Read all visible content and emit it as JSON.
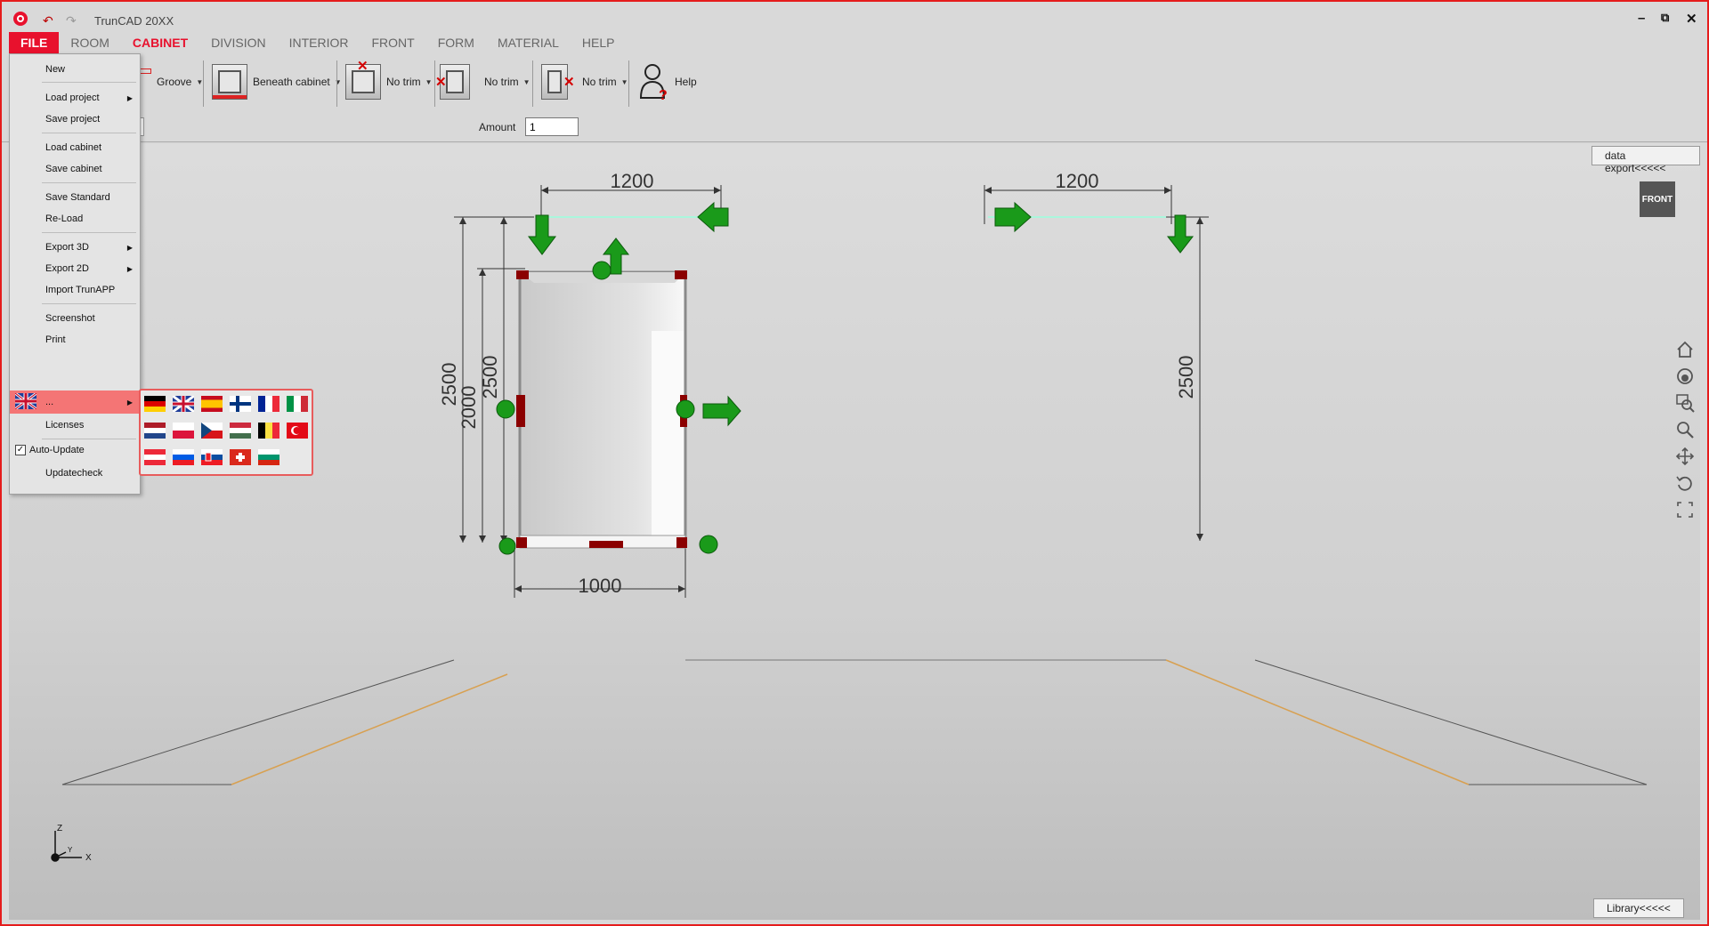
{
  "app": {
    "title": "TrunCAD 20XX",
    "window_controls": [
      "–",
      "⧉",
      "✕"
    ]
  },
  "menu": {
    "tabs": [
      {
        "label": "FILE"
      },
      {
        "label": "ROOM"
      },
      {
        "label": "CABINET"
      },
      {
        "label": "DIVISION"
      },
      {
        "label": "INTERIOR"
      },
      {
        "label": "FRONT"
      },
      {
        "label": "FORM"
      },
      {
        "label": "MATERIAL"
      },
      {
        "label": "HELP"
      }
    ]
  },
  "ribbon": {
    "groove_label": "Groove",
    "beneath_label": "Beneath cabinet",
    "trim1_label": "No trim",
    "trim2_label": "No trim",
    "trim3_label": "No trim",
    "help_label": "Help",
    "amount_label": "Amount",
    "amount_value": "1"
  },
  "file_menu": {
    "items": [
      {
        "label": "New"
      },
      {
        "label": "Load project"
      },
      {
        "label": "Save project"
      },
      {
        "label": "Load cabinet"
      },
      {
        "label": "Save cabinet"
      },
      {
        "label": "Save Standard"
      },
      {
        "label": "Re-Load"
      },
      {
        "label": "Export 3D"
      },
      {
        "label": "Export 2D"
      },
      {
        "label": "Import TrunAPP"
      },
      {
        "label": "Screenshot"
      },
      {
        "label": "Print"
      },
      {
        "label": "..."
      },
      {
        "label": "Licenses"
      },
      {
        "label": "Auto-Update"
      },
      {
        "label": "Updatecheck"
      }
    ],
    "auto_update_checked": true
  },
  "languages": [
    "german-flag",
    "uk-flag",
    "spanish-flag",
    "finnish-flag",
    "french-flag",
    "italian-flag",
    "dutch-flag",
    "polish-flag",
    "czech-flag",
    "hungarian-flag",
    "belgian-flag",
    "turkish-flag",
    "austrian-flag",
    "slovenian-flag-a",
    "slovenian-flag-b",
    "swiss-flag",
    "bulgarian-flag"
  ],
  "viewport": {
    "data_export": "data export<<<<<",
    "library": "Library<<<<<",
    "cube_label": "FRONT",
    "dim_left_width": "1200",
    "dim_right_width": "1200",
    "dim_height_outer": "2500",
    "dim_height_cab": "2000",
    "dim_height_inner": "2500",
    "dim_height_right": "2500",
    "dim_cab_width": "1000",
    "axis_z": "Z",
    "axis_x": "X",
    "axis_y": "Y"
  },
  "colors": {
    "accent": "#e8112d",
    "arrow_green": "#18a418",
    "corner_red": "#8b0000"
  }
}
